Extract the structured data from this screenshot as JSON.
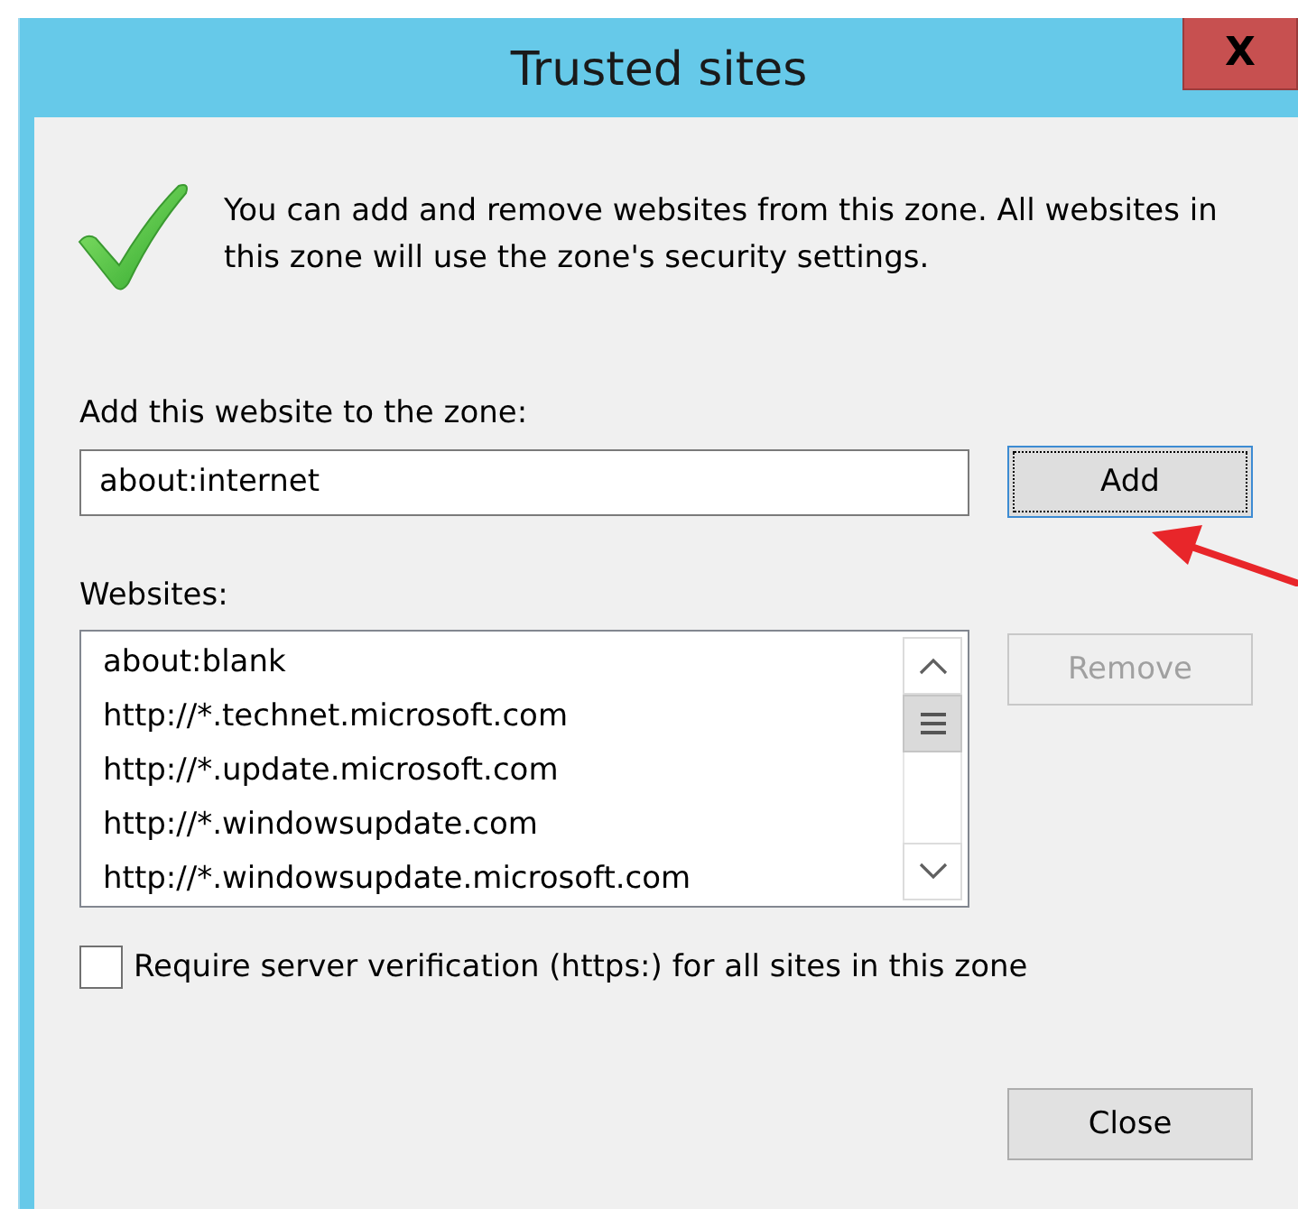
{
  "window": {
    "title": "Trusted sites",
    "close_glyph": "X"
  },
  "message": "You can add and remove websites from this zone. All websites in this zone will use the zone's security settings.",
  "add_field": {
    "label": "Add this website to the zone:",
    "value": "about:internet"
  },
  "websites": {
    "label": "Websites:",
    "items": [
      {
        "text": "about:blank"
      },
      {
        "text": "http://*.technet.microsoft.com"
      },
      {
        "text": "http://*.update.microsoft.com"
      },
      {
        "text": "http://*.windowsupdate.com"
      },
      {
        "text": "http://*.windowsupdate.microsoft.com"
      }
    ]
  },
  "require_https": {
    "label": "Require server verification (https:) for all sites in this zone",
    "checked": false
  },
  "buttons": [
    {
      "label": "Add",
      "focused": true,
      "disabled": false
    },
    {
      "label": "Remove",
      "focused": false,
      "disabled": true
    },
    {
      "label": "Close",
      "focused": false,
      "disabled": false
    }
  ]
}
